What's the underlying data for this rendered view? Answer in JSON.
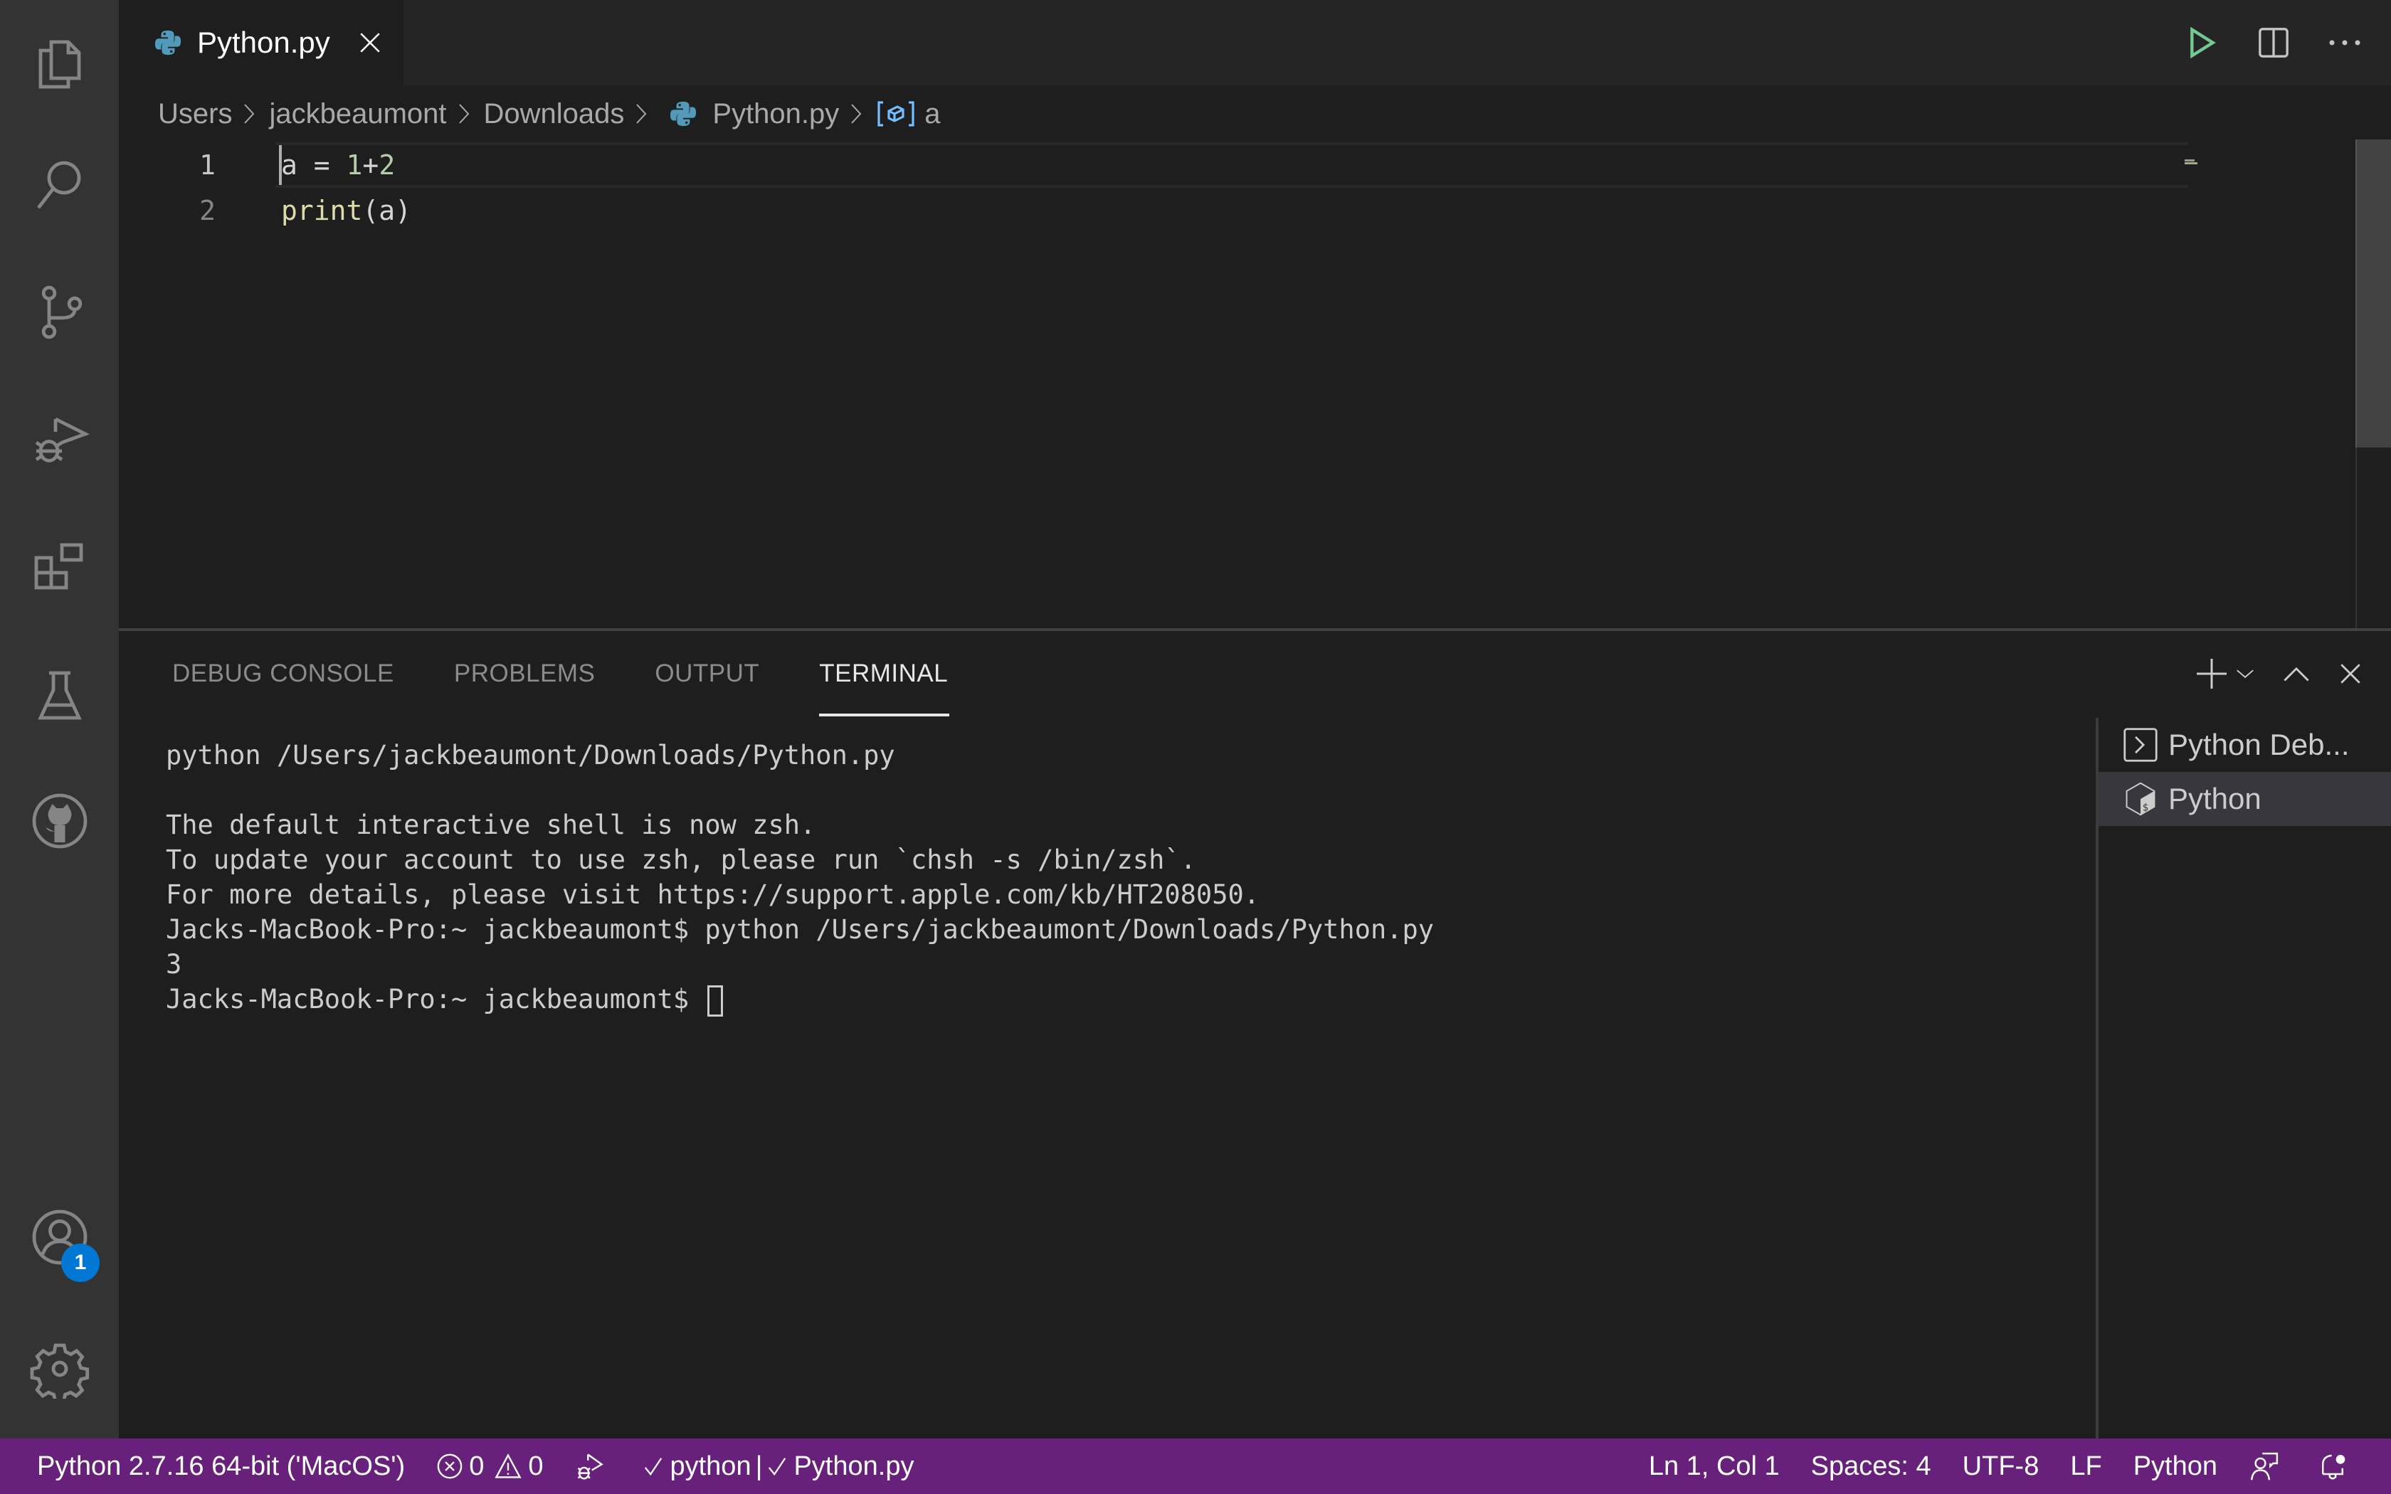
{
  "activity_bar": {
    "items": [
      {
        "name": "explorer",
        "icon": "files-icon"
      },
      {
        "name": "search",
        "icon": "search-icon"
      },
      {
        "name": "source-control",
        "icon": "source-control-icon"
      },
      {
        "name": "run-and-debug",
        "icon": "run-debug-icon"
      },
      {
        "name": "extensions",
        "icon": "extensions-icon"
      },
      {
        "name": "testing",
        "icon": "beaker-icon"
      },
      {
        "name": "github",
        "icon": "github-icon"
      }
    ],
    "accounts_badge": "1",
    "bottom_items": [
      {
        "name": "accounts",
        "icon": "account-icon"
      },
      {
        "name": "manage",
        "icon": "gear-icon"
      }
    ]
  },
  "tabs": [
    {
      "label": "Python.py",
      "icon": "python-icon",
      "active": true
    }
  ],
  "editor_actions": {
    "run": "play-icon",
    "split": "split-editor-icon",
    "more": "more-icon"
  },
  "breadcrumb": {
    "items": [
      "Users",
      "jackbeaumont",
      "Downloads",
      "Python.py",
      "a"
    ]
  },
  "editor": {
    "lines": [
      {
        "number": "1",
        "var": "a",
        "op": " = ",
        "num1": "1",
        "plus": "+",
        "num2": "2"
      },
      {
        "number": "2",
        "fn": "print",
        "args": "(a)"
      }
    ]
  },
  "panel": {
    "tabs": [
      "DEBUG CONSOLE",
      "PROBLEMS",
      "OUTPUT",
      "TERMINAL"
    ],
    "active_tab": "TERMINAL",
    "terminal_lines": [
      "python /Users/jackbeaumont/Downloads/Python.py",
      "",
      "The default interactive shell is now zsh.",
      "To update your account to use zsh, please run `chsh -s /bin/zsh`.",
      "For more details, please visit https://support.apple.com/kb/HT208050.",
      "Jacks-MacBook-Pro:~ jackbeaumont$ python /Users/jackbeaumont/Downloads/Python.py",
      "3",
      "Jacks-MacBook-Pro:~ jackbeaumont$ "
    ],
    "terminals": [
      {
        "label": "Python Deb...",
        "icon": "terminal-icon",
        "selected": false
      },
      {
        "label": "Python",
        "icon": "bash-icon",
        "selected": true
      }
    ]
  },
  "status_bar": {
    "interpreter": "Python 2.7.16 64-bit ('MacOS')",
    "errors": "0",
    "warnings": "0",
    "task_python": "python",
    "task_separator": "|",
    "task_file": "Python.py",
    "position": "Ln 1, Col 1",
    "indent": "Spaces: 4",
    "encoding": "UTF-8",
    "eol": "LF",
    "language": "Python",
    "color": "#68217a"
  }
}
